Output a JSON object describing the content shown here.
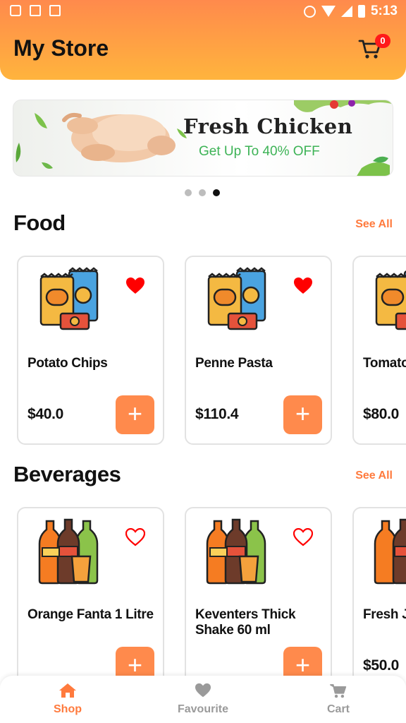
{
  "status_bar": {
    "time": "5:13"
  },
  "header": {
    "title": "My Store",
    "cart_count": "0"
  },
  "banner": {
    "title": "Fresh Chicken",
    "subtitle": "Get Up To 40% OFF",
    "slides": 3,
    "active_slide": 3
  },
  "sections": {
    "food": {
      "title": "Food",
      "see_all": "See All",
      "products": [
        {
          "name": "Potato Chips",
          "price": "$40.0",
          "favourite": true
        },
        {
          "name": "Penne Pasta",
          "price": "$110.4",
          "favourite": true
        },
        {
          "name": "Tomato",
          "price": "$80.0",
          "favourite": true
        }
      ]
    },
    "beverages": {
      "title": "Beverages",
      "see_all": "See All",
      "products": [
        {
          "name": "Orange Fanta 1 Litre",
          "price": "",
          "favourite": false
        },
        {
          "name": "Keventers Thick Shake 60 ml",
          "price": "",
          "favourite": false
        },
        {
          "name": "Fresh J",
          "price": "$50.0",
          "favourite": false
        }
      ]
    }
  },
  "bottom_nav": {
    "items": [
      {
        "label": "Shop",
        "icon": "home-icon",
        "active": true
      },
      {
        "label": "Favourite",
        "icon": "heart-icon",
        "active": false
      },
      {
        "label": "Cart",
        "icon": "cart-icon",
        "active": false
      }
    ]
  },
  "colors": {
    "accent": "#ff8a4c",
    "accent_text": "#ff7a3d",
    "favourite": "#ff0000",
    "badge": "#ff1a1a",
    "promo_green": "#3db356"
  }
}
